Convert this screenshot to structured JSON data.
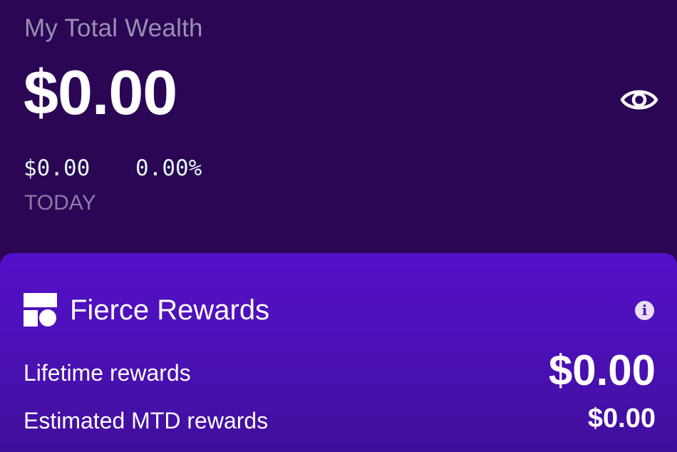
{
  "wealth": {
    "title": "My Total Wealth",
    "amount": "$0.00",
    "day_change": "$0.00",
    "day_change_percent": "0.00%",
    "period_label": "TODAY",
    "visibility_icon": "eye-icon"
  },
  "rewards": {
    "title": "Fierce Rewards",
    "logo_icon": "fierce-logo-icon",
    "info_glyph": "i",
    "lifetime_label": "Lifetime rewards",
    "lifetime_value": "$0.00",
    "mtd_label": "Estimated MTD rewards",
    "mtd_value": "$0.00"
  },
  "colors": {
    "background": "#2a0655",
    "card": "#5410c9",
    "positive_text": "#e6f7ef"
  }
}
